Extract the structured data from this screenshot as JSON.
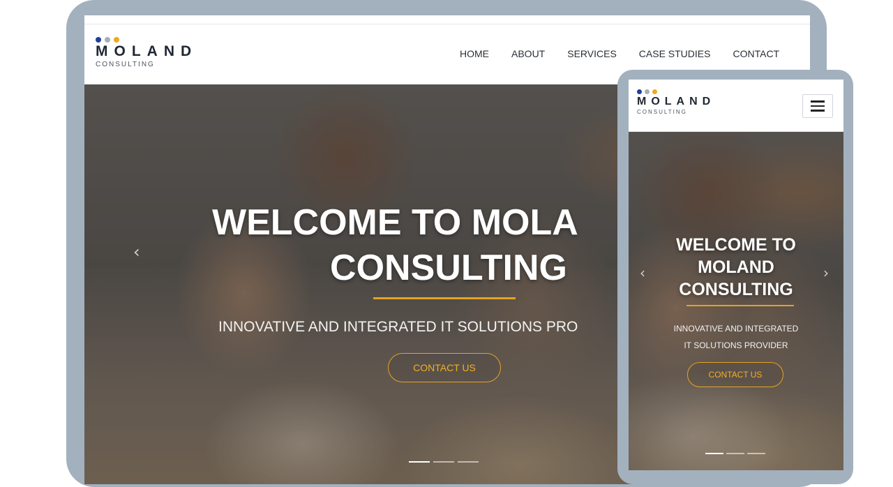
{
  "brand": {
    "name": "MOLAND",
    "tagline": "CONSULTING",
    "dot_colors": [
      "#1f3f9a",
      "#a8aeb6",
      "#f0a81c"
    ]
  },
  "nav": {
    "items": [
      {
        "label": "HOME"
      },
      {
        "label": "ABOUT"
      },
      {
        "label": "SERVICES"
      },
      {
        "label": "CASE STUDIES"
      },
      {
        "label": "CONTACT"
      }
    ]
  },
  "desktop_hero": {
    "title_line1": "WELCOME TO MOLA",
    "title_line2": "CONSULTING",
    "subtitle": "INNOVATIVE AND INTEGRATED IT SOLUTIONS PRO",
    "cta": "CONTACT US",
    "prev_icon": "‹",
    "slide_count": 3,
    "active_slide": 1
  },
  "mobile_hero": {
    "title_line1": "WELCOME TO",
    "title_line2": "MOLAND",
    "title_line3": "CONSULTING",
    "subtitle_line1": "INNOVATIVE AND INTEGRATED",
    "subtitle_line2": "IT SOLUTIONS PROVIDER",
    "cta": "CONTACT US",
    "prev_icon": "‹",
    "next_icon": "›",
    "slide_count": 3,
    "active_slide": 1
  },
  "colors": {
    "accent": "#e5a321",
    "frame": "#a3b1be"
  }
}
